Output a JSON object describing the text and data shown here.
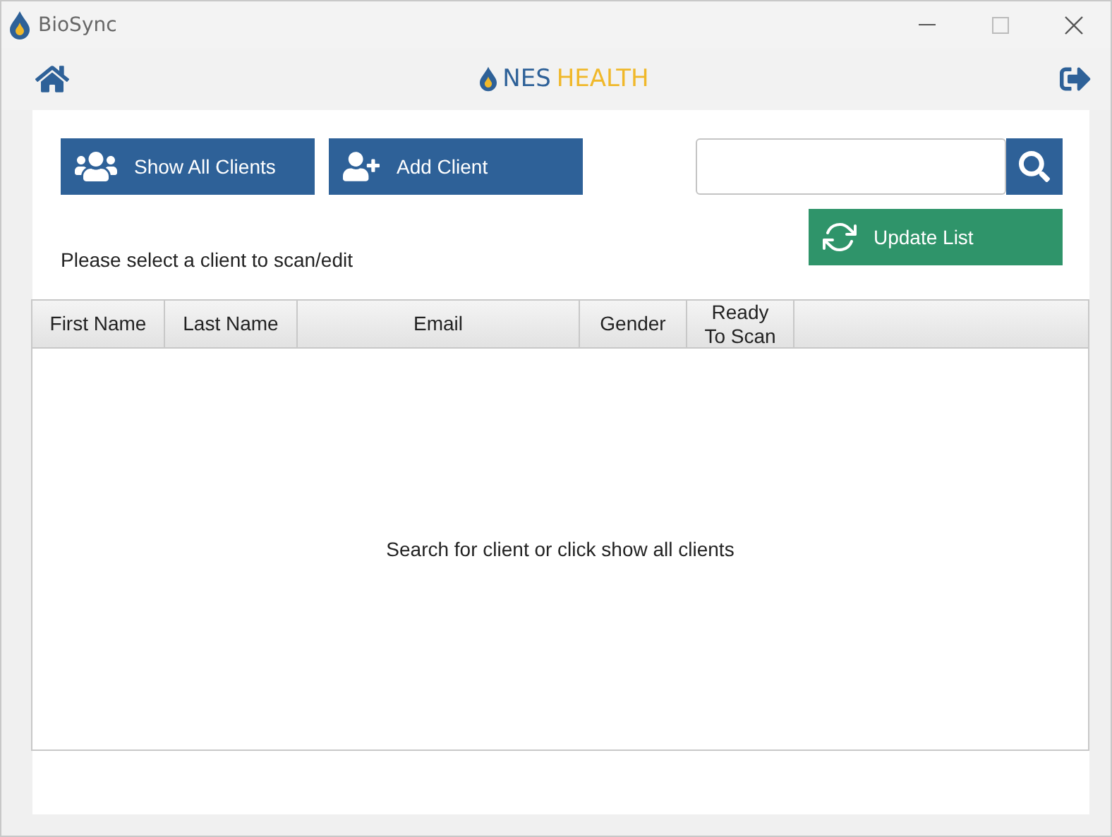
{
  "window": {
    "title": "BioSync"
  },
  "logo": {
    "primary": "NES",
    "secondary": "HEALTH"
  },
  "buttons": [
    {
      "kind": "clients",
      "label": "Show All Clients"
    },
    {
      "kind": "add",
      "label": "Add Client"
    }
  ],
  "update_button": {
    "label": "Update List"
  },
  "instruction": "Please select a client to scan/edit",
  "table": {
    "columns": [
      "First Name",
      "Last Name",
      "Email",
      "Gender",
      "Ready To Scan"
    ],
    "empty_message": "Search for client or click show all clients"
  }
}
